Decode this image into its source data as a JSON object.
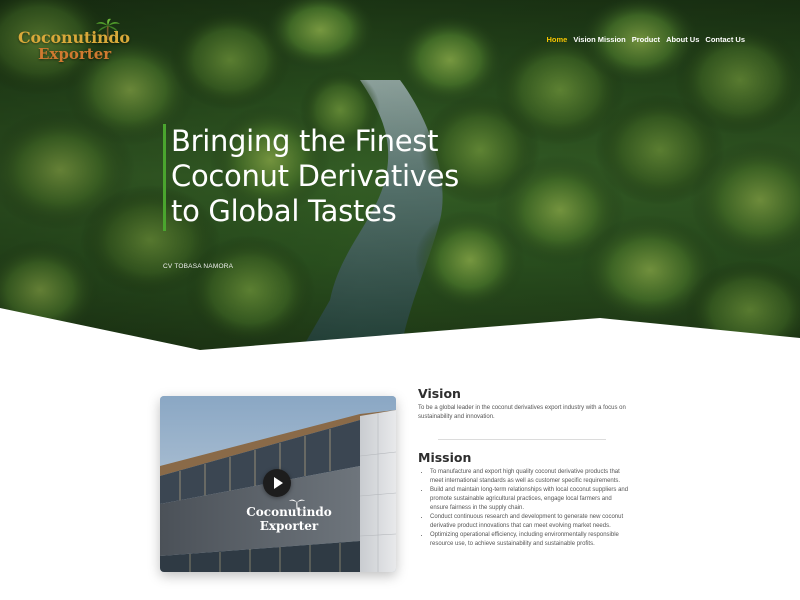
{
  "logo": {
    "line1": "Coconutindo",
    "line2": "Exporter",
    "palm_icon": "palm-tree-icon"
  },
  "nav": {
    "items": [
      {
        "label": "Home",
        "active": true
      },
      {
        "label": "Vision Mission",
        "active": false
      },
      {
        "label": "Product",
        "active": false
      },
      {
        "label": "About Us",
        "active": false
      },
      {
        "label": "Contact Us",
        "active": false
      }
    ],
    "active_color": "#f4c400"
  },
  "hero": {
    "title_lines": [
      "Bringing the Finest",
      "Coconut Derivatives",
      "to Global Tastes"
    ],
    "subtitle": "CV TOBASA NAMORA",
    "accent_color": "#4aa52e"
  },
  "video": {
    "play_icon": "play-icon",
    "sign_line1": "Coconutindo",
    "sign_line2": "Exporter"
  },
  "vision": {
    "title": "Vision",
    "text": "To be a global leader in the coconut derivatives export industry with a focus on sustainability and innovation."
  },
  "mission": {
    "title": "Mission",
    "items": [
      "To manufacture and export high quality coconut derivative products that meet international standards as well as customer specific requirements.",
      "Build and maintain long-term relationships with local coconut suppliers and promote sustainable agricultural practices, engage local farmers and ensure fairness in the supply chain.",
      "Conduct continuous research and development to generate new coconut derivative product innovations that can meet evolving market needs.",
      "Optimizing operational efficiency, including environmentally responsible resource use, to achieve sustainability and sustainable profits."
    ]
  }
}
